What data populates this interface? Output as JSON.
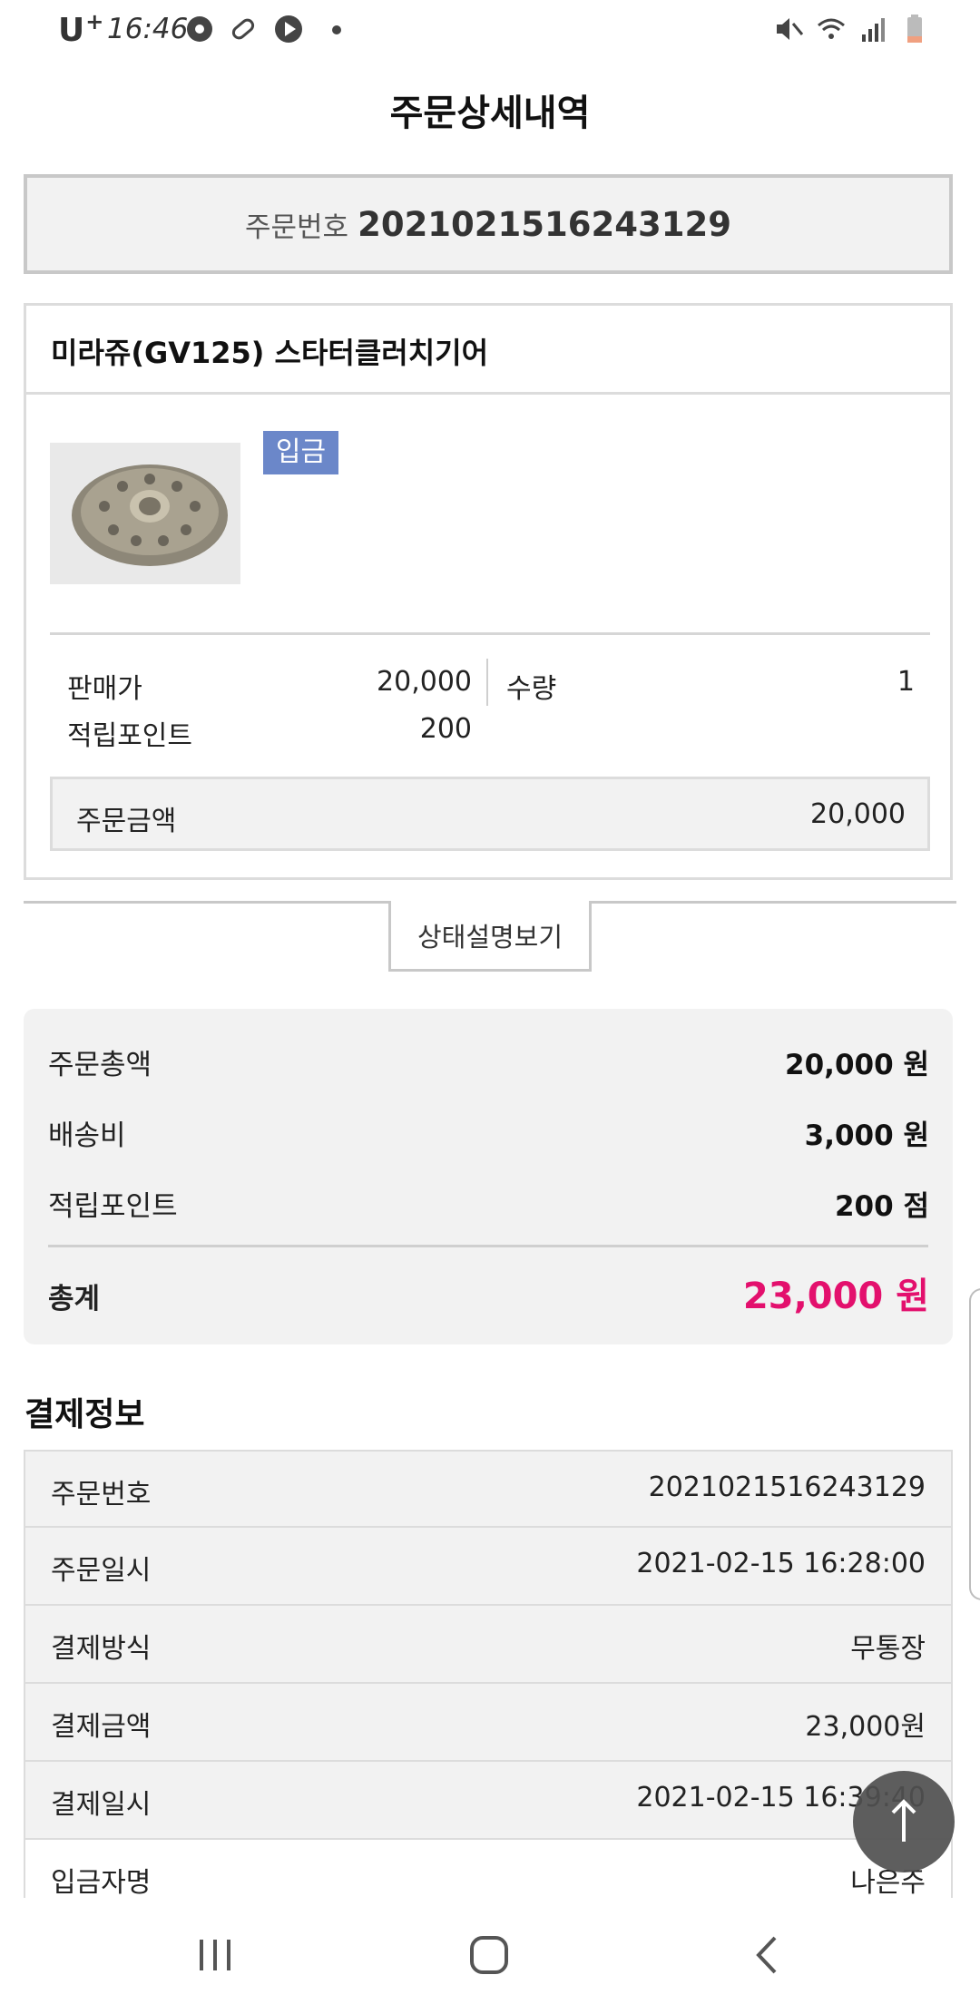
{
  "status_bar": {
    "carrier": "U",
    "carrier_sup": "+",
    "time": "16:46"
  },
  "header": {
    "title": "주문상세내역"
  },
  "order_number_box": {
    "label": "주문번호",
    "value": "2021021516243129"
  },
  "product": {
    "name": "미라쥬(GV125) 스타터클러치기어",
    "status_badge": "입금",
    "image_icon": "gear-image",
    "price_label": "판매가",
    "price_value": "20,000",
    "qty_label": "수량",
    "qty_value": "1",
    "points_label": "적립포인트",
    "points_value": "200",
    "order_amount_label": "주문금액",
    "order_amount_value": "20,000"
  },
  "status_explain_button": "상태설명보기",
  "summary": {
    "rows": [
      {
        "label": "주문총액",
        "value": "20,000 원"
      },
      {
        "label": "배송비",
        "value": "3,000 원"
      },
      {
        "label": "적립포인트",
        "value": "200 점"
      }
    ],
    "total_label": "총계",
    "total_value": "23,000 원",
    "total_color": "#e3106d"
  },
  "payment_info": {
    "title": "결제정보",
    "rows": [
      {
        "label": "주문번호",
        "value": "2021021516243129"
      },
      {
        "label": "주문일시",
        "value": "2021-02-15 16:28:00"
      },
      {
        "label": "결제방식",
        "value": "무통장"
      },
      {
        "label": "결제금액",
        "value": "23,000원"
      },
      {
        "label": "결제일시",
        "value": "2021-02-15 16:39:40"
      },
      {
        "label": "입금자명",
        "value": "나은주"
      }
    ]
  },
  "colors": {
    "badge": "#6b87c9",
    "accent_total": "#e3106d",
    "panel_bg": "#f2f2f2"
  }
}
